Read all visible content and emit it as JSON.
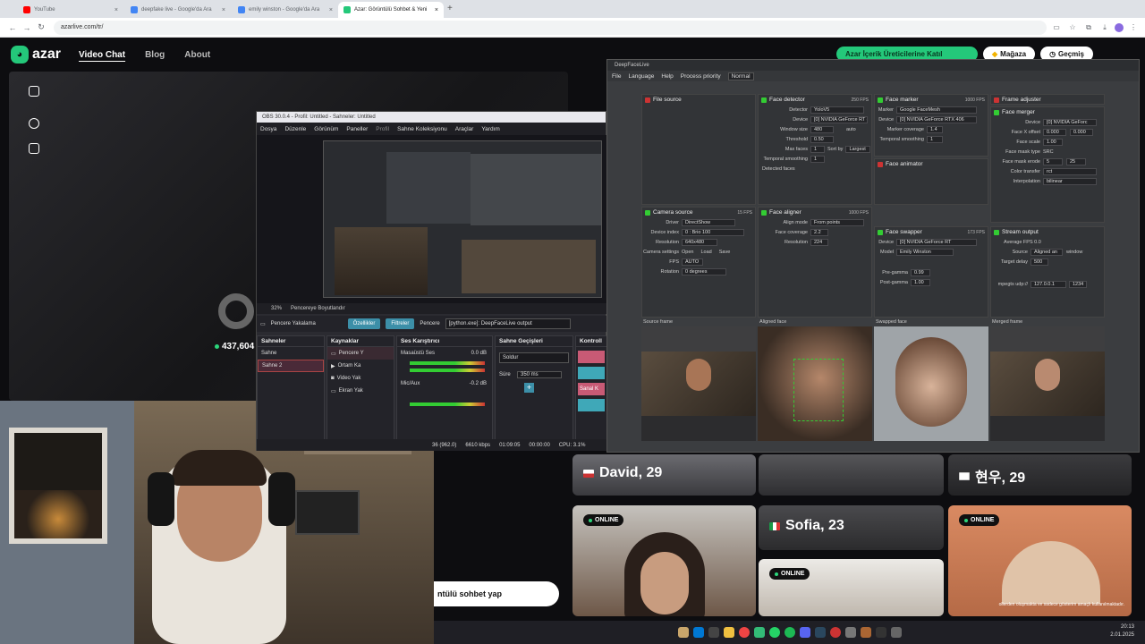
{
  "browser": {
    "tabs": [
      {
        "title": "YouTube",
        "color": "#ff0000"
      },
      {
        "title": "deepfake live - Google'da Ara",
        "color": "#4285f4"
      },
      {
        "title": "emily winston - Google'da Ara",
        "color": "#4285f4"
      },
      {
        "title": "Azar: Görüntülü Sohbet & Yeni",
        "color": "#24c87a"
      }
    ],
    "url": "azarlive.com/tr/"
  },
  "azar": {
    "brand": "azar",
    "nav": [
      "Video Chat",
      "Blog",
      "About"
    ],
    "creators_button": "Azar İçerik Üreticilerine Katıl",
    "store_button": "Mağaza",
    "history_button": "Geçmiş",
    "online_count": "437,604",
    "chat_button": "ntülü sohbet yap",
    "cards": [
      {
        "name": "David, 29",
        "online": false
      },
      {
        "name": "현우, 29",
        "online": false
      },
      {
        "name": "Sofia, 23",
        "online": false
      },
      {
        "name": "",
        "online": true,
        "badge": "ONLINE"
      },
      {
        "name": "",
        "online": true,
        "badge": "ONLINE"
      },
      {
        "name": "",
        "online": true,
        "badge": "ONLINE"
      }
    ],
    "footer_note": "ollerden oluşmakta ve sadece gösterim amaçlı kullanılmaktadır."
  },
  "obs": {
    "title": "OBS 30.0.4 - Profil: Untitled - Sahneler: Untitled",
    "menu": [
      "Dosya",
      "Düzenle",
      "Görünüm",
      "Paneller",
      "Profil",
      "Sahne Koleksiyonu",
      "Araçlar",
      "Yardım"
    ],
    "zoom": "32%",
    "preview_scale": "Pencereye Boyutlandır",
    "source_label": "Pencere Yakalama",
    "props_button": "Özellikler",
    "filters_button": "Filtreler",
    "window_label": "Pencere",
    "window_value": "[python.exe]: DeepFaceLive output",
    "docks": {
      "scenes": {
        "title": "Sahneler",
        "items": [
          "Sahne",
          "Sahne 2"
        ]
      },
      "sources": {
        "title": "Kaynaklar",
        "items": [
          "Pencere Y",
          "Ortam Ka",
          "Video Yak",
          "Ekran Yak"
        ]
      },
      "mixer": {
        "title": "Ses Karıştırıcı",
        "items": [
          {
            "name": "Masaüstü Ses",
            "db": "0.0 dB"
          },
          {
            "name": "Mic/Aux",
            "db": "-0.2 dB"
          }
        ]
      },
      "transitions": {
        "title": "Sahne Geçişleri",
        "type": "Soldur",
        "duration_label": "Süre",
        "duration": "350 ms"
      },
      "controls": {
        "title": "Kontroll",
        "virtual_cam": "Sanal K"
      }
    },
    "status": {
      "kbps": "6610 kbps",
      "time1": "01:09:05",
      "time2": "00:00:00",
      "cpu": "CPU: 3.1%",
      "fps": "36 (962.0)"
    }
  },
  "dfl": {
    "title": "DeepFaceLive",
    "menu": [
      "File",
      "Language",
      "Help",
      "Process priority",
      "Normal"
    ],
    "file_source": "File source",
    "face_detector": {
      "title": "Face detector",
      "fps": "250 FPS",
      "detector": "YoloV5",
      "device": "[0] NVIDIA GeForce RT 40",
      "window_size": "480",
      "auto": "auto",
      "threshold": "0.50",
      "max_faces": "1",
      "sort_by": "Largest",
      "temporal_smoothing": "1",
      "detected": "Detected faces"
    },
    "face_marker": {
      "title": "Face marker",
      "fps": "1000 FPS",
      "marker": "Google FaceMesh",
      "device": "[0] NVIDIA GeForce RTX 406",
      "coverage": "1.4",
      "smoothing": "1"
    },
    "face_animator": "Face animator",
    "frame_adjuster": "Frame adjuster",
    "face_merger": {
      "title": "Face merger",
      "device": "[0] NVIDIA GeForc",
      "x_offset": "0.000",
      "y_offset": "0.000",
      "face_scale": "1.00",
      "mask_type": "SRC",
      "mask_erode": "5",
      "mask_blur": "25",
      "color_transfer": "rct",
      "interpolation": "bilinear"
    },
    "camera_source": {
      "title": "Camera source",
      "fps": "15 FPS",
      "driver": "DirectShow",
      "device_index": "0 : Brio 100",
      "resolution": "640x480",
      "fps_val": "AUTO",
      "rotation": "0 degrees",
      "open": "Open",
      "load": "Load",
      "save": "Save"
    },
    "face_aligner": {
      "title": "Face aligner",
      "fps": "1000 FPS",
      "align_mode": "From points",
      "coverage": "2.2",
      "resolution": "224"
    },
    "face_swapper": {
      "title": "Face swapper",
      "fps": "173 FPS",
      "device": "[0] NVIDIA GeForce RT",
      "model": "Emily Winston",
      "pregamma": "0.99",
      "postgamma": "1.00"
    },
    "stream_output": {
      "title": "Stream output",
      "avg_fps": "Average FPS 0.0",
      "source": "Aligned an",
      "window": "window",
      "target_delay": "500",
      "address": "127.0.0.1",
      "port": "1234"
    },
    "frames": [
      "Source frame",
      "Aligned face",
      "Swapped face",
      "Merged frame"
    ]
  },
  "tray": {
    "time": "20:13",
    "date": "2.01.2025"
  }
}
